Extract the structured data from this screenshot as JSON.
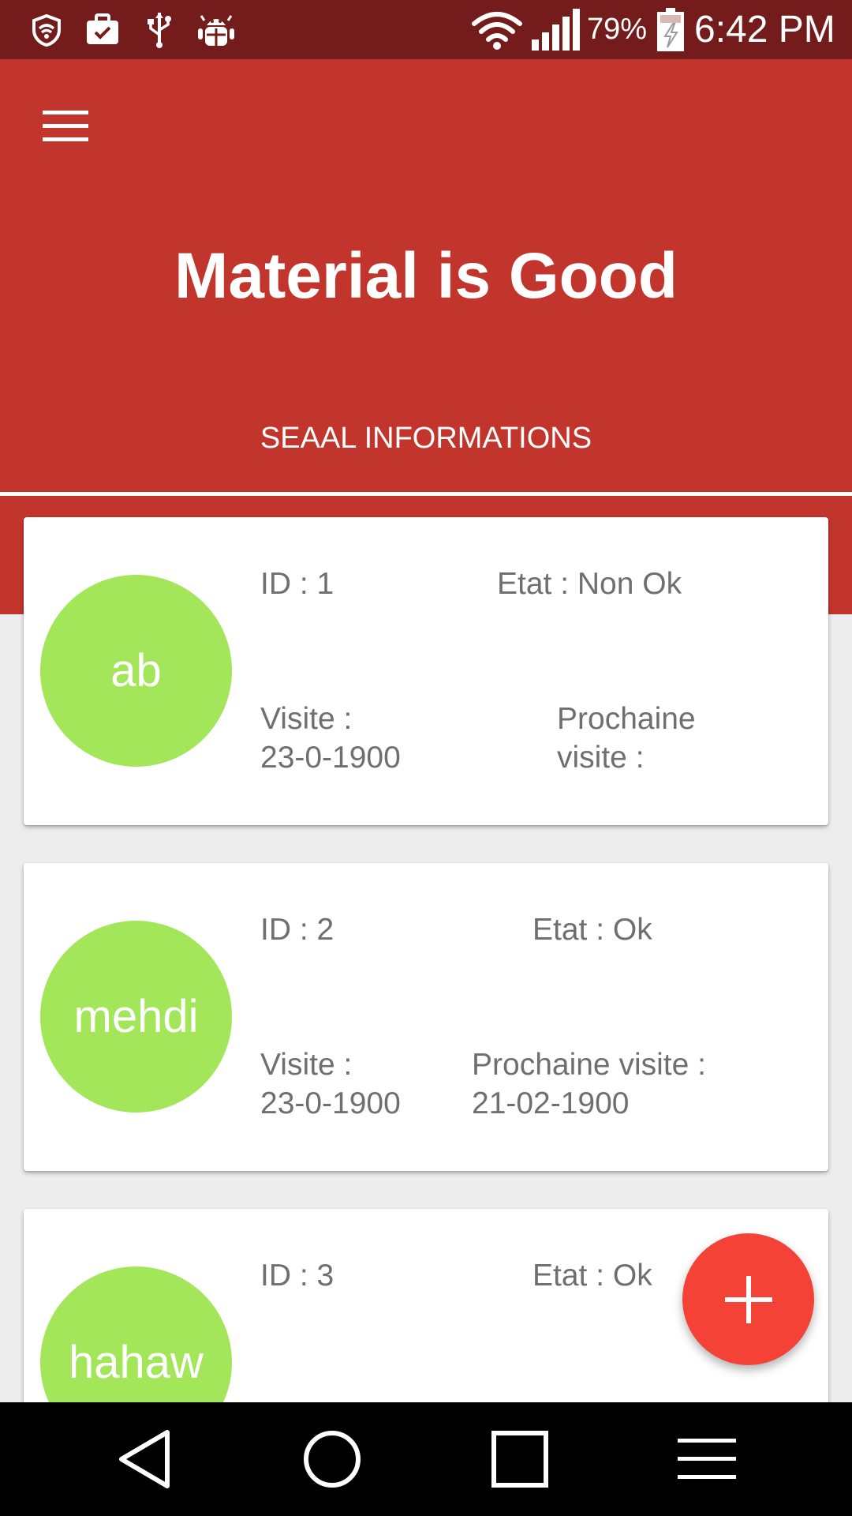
{
  "status_bar": {
    "icons": [
      "shield-wifi-icon",
      "briefcase-check-icon",
      "usb-icon",
      "android-debug-icon",
      "wifi-icon",
      "signal-icon",
      "battery-charging-icon"
    ],
    "battery_percent": "79%",
    "time": "6:42 PM"
  },
  "app_bar": {
    "title": "Material is Good",
    "menu_icon": "hamburger-menu-icon",
    "tab_label": "SEAAL INFORMATIONS"
  },
  "cards": [
    {
      "avatar_text": "ab",
      "id_text": "ID : 1",
      "etat_text": "Etat : Non Ok",
      "visite_label": "Visite :",
      "visite_date": "23-0-1900",
      "prochaine_line1": "Prochaine",
      "prochaine_line2": "visite :"
    },
    {
      "avatar_text": "mehdi",
      "id_text": "ID : 2",
      "etat_text": "Etat : Ok",
      "visite_label": "Visite :",
      "visite_date": "23-0-1900",
      "prochaine_line1": "Prochaine visite :",
      "prochaine_line2": "21-02-1900"
    },
    {
      "avatar_text": "hahaw",
      "id_text": "ID : 3",
      "etat_text": "Etat : Ok"
    }
  ],
  "fab": {
    "icon": "plus-icon"
  },
  "nav_bar": {
    "icons": [
      "back-icon",
      "home-icon",
      "recents-icon",
      "menu-icon"
    ]
  },
  "colors": {
    "status_bar": "#731c1b",
    "primary": "#c2352d",
    "avatar": "#a3e65a",
    "fab": "#f44336",
    "background": "#ededed"
  }
}
